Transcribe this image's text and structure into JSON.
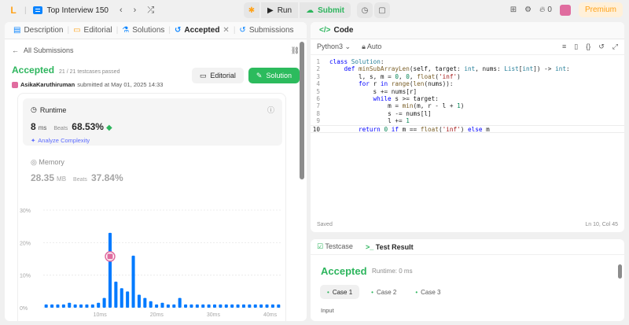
{
  "topbar": {
    "logo": "L",
    "list_title": "Top Interview 150",
    "prev": "‹",
    "next": "›",
    "shuffle": "⤮",
    "run_label": "Run",
    "submit_label": "Submit",
    "streak_count": "0",
    "premium_label": "Premium"
  },
  "left_tabs": [
    {
      "label": "Description"
    },
    {
      "label": "Editorial"
    },
    {
      "label": "Solutions"
    },
    {
      "label": "Accepted"
    },
    {
      "label": "Submissions"
    }
  ],
  "submission": {
    "back_label": "All Submissions",
    "status": "Accepted",
    "testcases": "21 / 21 testcases passed",
    "user": "AsikaKaruthiruman",
    "submitted_at": "submitted at May 01, 2025 14:33",
    "editorial_btn": "Editorial",
    "solution_btn": "Solution",
    "runtime_title": "Runtime",
    "runtime_value": "8",
    "runtime_unit": "ms",
    "beats_label": "Beats",
    "runtime_beats": "68.53%",
    "analyze_label": "Analyze Complexity",
    "memory_title": "Memory",
    "memory_value": "28.35",
    "memory_unit": "MB",
    "memory_beats": "37.84%"
  },
  "chart_data": {
    "type": "bar",
    "y_ticks": [
      "30%",
      "20%",
      "10%",
      "0%"
    ],
    "ylim": [
      0,
      30
    ],
    "x_ticks": [
      "10ms",
      "20ms",
      "30ms",
      "40ms"
    ],
    "xlim": [
      0,
      42
    ],
    "values": [
      1,
      1,
      1,
      1,
      1.5,
      1,
      1,
      1,
      1,
      1.5,
      3,
      23,
      8,
      6,
      5,
      16,
      4,
      3,
      2,
      1,
      1.5,
      1,
      1,
      3,
      1,
      1,
      1,
      1,
      1,
      1,
      1,
      1,
      1,
      1,
      1,
      1,
      1,
      1,
      1,
      1,
      1
    ],
    "highlight_index": 11,
    "bar_color": "#007aff",
    "highlight_color": "#e06c9f"
  },
  "code_panel": {
    "title": "Code",
    "language": "Python3",
    "mode": "Auto",
    "saved": "Saved",
    "position": "Ln 10, Col 45",
    "lines": [
      "class Solution:",
      "    def minSubArrayLen(self, target: int, nums: List[int]) -> int:",
      "        l, s, m = 0, 0, float('inf')",
      "        for r in range(len(nums)):",
      "            s += nums[r]",
      "            while s >= target:",
      "                m = min(m, r - l + 1)",
      "                s -= nums[l]",
      "                l += 1",
      "        return 0 if m == float('inf') else m"
    ]
  },
  "result_panel": {
    "tab_testcase": "Testcase",
    "tab_result": "Test Result",
    "status": "Accepted",
    "runtime": "Runtime: 0 ms",
    "cases": [
      "Case 1",
      "Case 2",
      "Case 3"
    ],
    "input_label": "Input"
  }
}
